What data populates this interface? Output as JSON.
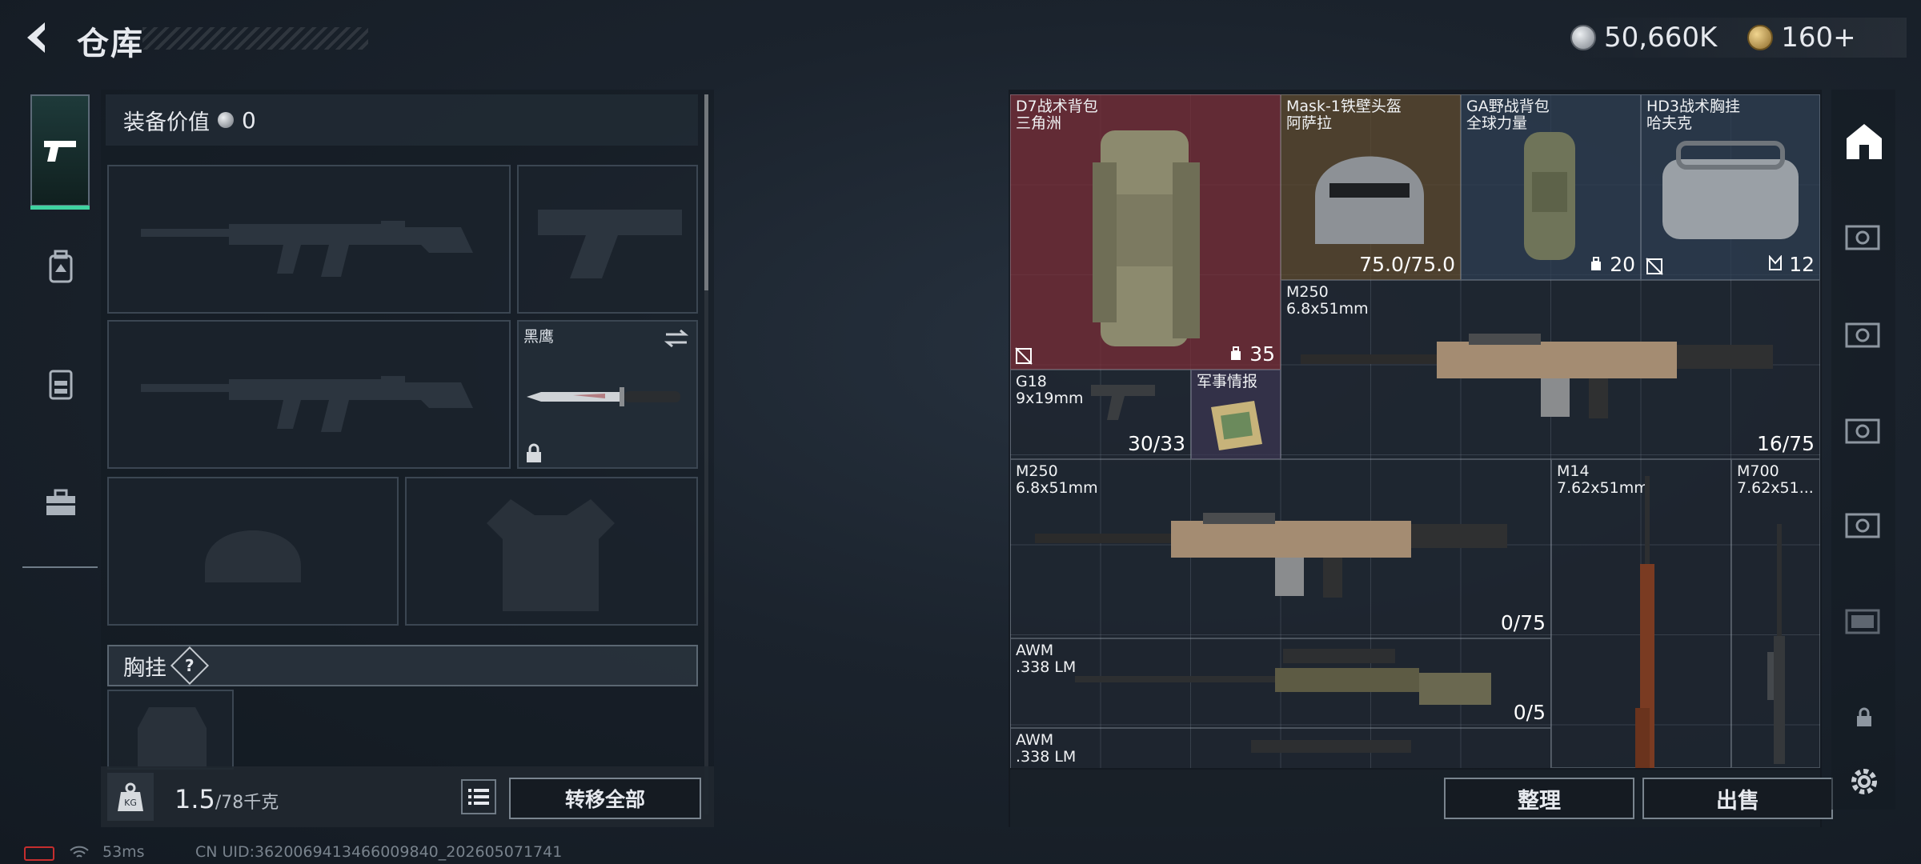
{
  "header": {
    "title": "仓库",
    "currency_1": "50,660K",
    "currency_2": "160+"
  },
  "left_rail": {
    "items": [
      "weapons-icon",
      "backpack-icon",
      "vest-icon",
      "toolbox-icon"
    ],
    "active": "weapons-icon"
  },
  "loadout": {
    "equip_value_label": "装备价值",
    "equip_value": "0",
    "knife_name": "黑鹰",
    "rig_section_label": "胸挂",
    "help": "?",
    "weight_current": "1.5",
    "weight_max": "/78千克",
    "weight_icon_text": "KG",
    "transfer_all": "转移全部"
  },
  "stash": {
    "items": [
      {
        "name": "D7战术背包",
        "sub": "三角洲",
        "count": "35"
      },
      {
        "name": "Mask-1铁壁头盔",
        "sub": "阿萨拉",
        "count": "75.0/75.0"
      },
      {
        "name": "GA野战背包",
        "sub": "全球力量",
        "count": "20"
      },
      {
        "name": "HD3战术胸挂",
        "sub": "哈夫克",
        "count": "12"
      },
      {
        "name": "M250",
        "sub": "6.8x51mm",
        "count": "16/75"
      },
      {
        "name": "G18",
        "sub": "9x19mm",
        "count": "30/33"
      },
      {
        "name": "军事情报",
        "sub": "",
        "count": ""
      },
      {
        "name": "M250",
        "sub": "6.8x51mm",
        "count": "0/75"
      },
      {
        "name": "M14",
        "sub": "7.62x51mm",
        "count": ""
      },
      {
        "name": "M700",
        "sub": "7.62x51...",
        "count": ""
      },
      {
        "name": "AWM",
        "sub": ".338 LM",
        "count": "0/5"
      },
      {
        "name": "AWM",
        "sub": ".338 LM",
        "count": ""
      }
    ],
    "sort_label": "整理",
    "sell_label": "出售"
  },
  "right_rail": {
    "items": [
      "stash-icon",
      "case-icon",
      "case-iv-icon",
      "case-iv-icon",
      "case-iv-icon",
      "case-iv-icon",
      "lock-icon",
      "settings-icon"
    ]
  },
  "status": {
    "ping": "53ms",
    "uid": "CN UID:3620069413466009840_202605071741"
  },
  "colors": {
    "accent_green": "#3fd3a0",
    "rarity_red": "#7a2d37",
    "rarity_gold": "#5e4a2e",
    "rarity_blue": "#2d3d52",
    "rarity_purple": "#3b3550"
  }
}
